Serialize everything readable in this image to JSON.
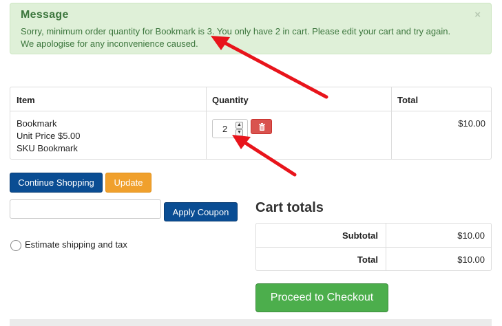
{
  "message": {
    "title": "Message",
    "line1": "Sorry, minimum order quantity for Bookmark is 3. You only have 2 in cart. Please edit your cart and try again.",
    "line2": "We apologise for any inconvenience caused.",
    "close": "×"
  },
  "cart": {
    "headers": {
      "item": "Item",
      "quantity": "Quantity",
      "total": "Total"
    },
    "row": {
      "name": "Bookmark",
      "unit_price": "Unit Price $5.00",
      "sku": "SKU Bookmark",
      "quantity": "2",
      "total": "$10.00"
    }
  },
  "buttons": {
    "continue": "Continue Shopping",
    "update": "Update",
    "apply_coupon": "Apply Coupon",
    "checkout": "Proceed to Checkout"
  },
  "coupon": {
    "value": "",
    "placeholder": ""
  },
  "shipping": {
    "label": "Estimate shipping and tax"
  },
  "totals": {
    "title": "Cart totals",
    "subtotal_label": "Subtotal",
    "subtotal_value": "$10.00",
    "total_label": "Total",
    "total_value": "$10.00"
  },
  "colors": {
    "alert_bg": "#dff0d8",
    "alert_text": "#3c763d",
    "primary": "#0a4d93",
    "warning": "#f0a02c",
    "success": "#4cae4c",
    "danger": "#d9534f",
    "annotation_arrow": "#e8141b"
  },
  "icons": {
    "delete": "trash-icon",
    "spin_up": "chevron-up-icon",
    "spin_down": "chevron-down-icon"
  }
}
